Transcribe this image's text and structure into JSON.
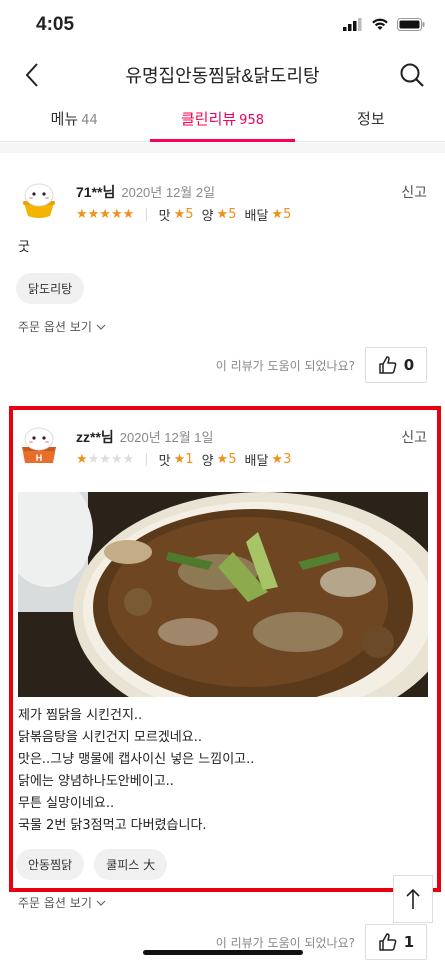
{
  "status": {
    "time": "4:05"
  },
  "header": {
    "title": "유명집안동찜닭&닭도리탕"
  },
  "tabs": [
    {
      "label": "메뉴",
      "count": "44"
    },
    {
      "label": "클린리뷰",
      "count": "958"
    },
    {
      "label": "정보",
      "count": ""
    }
  ],
  "reviews": [
    {
      "nickname": "71**님",
      "date": "2020년 12월 2일",
      "report": "신고",
      "stars_filled": 5,
      "taste_label": "맛",
      "taste": "5",
      "amount_label": "양",
      "amount": "5",
      "delivery_label": "배달",
      "delivery": "5",
      "text": "굿",
      "tags": [
        "닭도리탕"
      ],
      "order_option": "주문 옵션 보기",
      "helpful_question": "이 리뷰가 도움이 되었나요?",
      "likes": "0"
    },
    {
      "nickname": "zz**님",
      "date": "2020년 12월 1일",
      "report": "신고",
      "stars_filled": 1,
      "taste_label": "맛",
      "taste": "1",
      "amount_label": "양",
      "amount": "5",
      "delivery_label": "배달",
      "delivery": "3",
      "text_lines": [
        "제가 찜닭을 시킨건지..",
        "닭볶음탕을 시킨건지 모르겠네요..",
        "맛은..그냥 맹물에 캡사이신 넣은 느낌이고..",
        "닭에는 양념하나도안베이고..",
        "무튼 실망이네요..",
        "국물 2번 닭3점먹고 다버렸습니다."
      ],
      "tags": [
        "안동찜닭",
        "쿨피스 大"
      ],
      "order_option": "주문 옵션 보기",
      "helpful_question": "이 리뷰가 도움이 되었나요?",
      "likes": "1"
    }
  ],
  "colors": {
    "accent": "#fa0050",
    "star": "#f0901b",
    "highlight": "#e60012"
  }
}
